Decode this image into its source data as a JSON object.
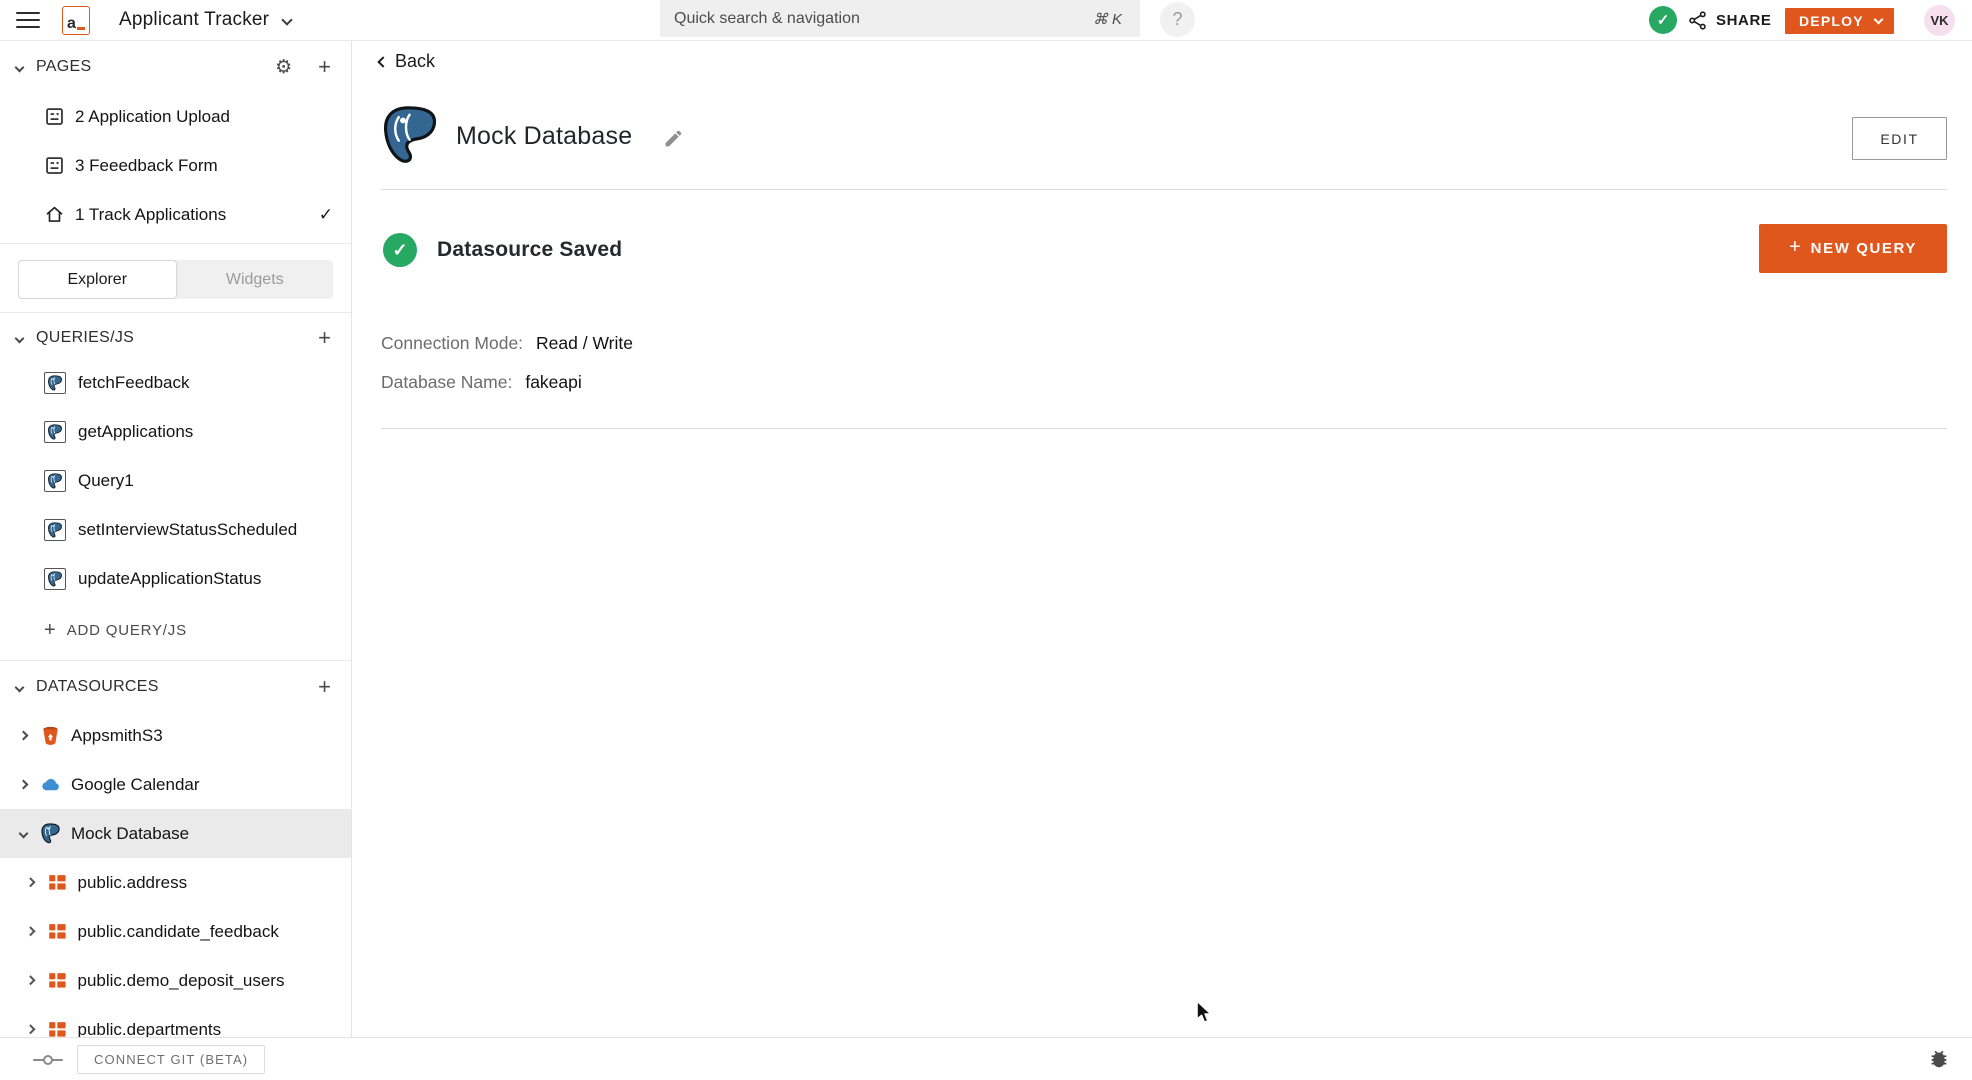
{
  "topbar": {
    "logo_glyph": "a",
    "app_title": "Applicant Tracker",
    "search": {
      "placeholder": "Quick search & navigation",
      "shortcut": "⌘ K"
    },
    "help_label": "?",
    "share_label": "SHARE",
    "deploy_label": "DEPLOY",
    "avatar_initials": "VK"
  },
  "sidebar": {
    "sections": {
      "pages": "PAGES",
      "queries": "QUERIES/JS",
      "datasources": "DATASOURCES"
    },
    "pages": [
      {
        "label": "2 Application Upload"
      },
      {
        "label": "3 Feeedback Form"
      },
      {
        "label": "1 Track Applications",
        "active": true
      }
    ],
    "tabs": [
      {
        "label": "Explorer",
        "active": true
      },
      {
        "label": "Widgets",
        "active": false
      }
    ],
    "queries": [
      "fetchFeedback",
      "getApplications",
      "Query1",
      "setInterviewStatusScheduled",
      "updateApplicationStatus"
    ],
    "add_query_label": "ADD QUERY/JS",
    "datasources": [
      {
        "label": "AppsmithS3"
      },
      {
        "label": "Google Calendar"
      },
      {
        "label": "Mock Database",
        "selected": true,
        "expanded": true
      }
    ],
    "tables": [
      "public.address",
      "public.candidate_feedback",
      "public.demo_deposit_users",
      "public.departments"
    ]
  },
  "bottombar": {
    "connect_git_label": "CONNECT GIT (BETA)"
  },
  "main": {
    "back_label": "Back",
    "title": "Mock Database",
    "edit_label": "EDIT",
    "status_text": "Datasource Saved",
    "plus_glyph": "+",
    "new_query_label": "NEW QUERY",
    "fields": [
      {
        "label": "Connection Mode:",
        "value": "Read / Write"
      },
      {
        "label": "Database Name:",
        "value": "fakeapi"
      }
    ]
  },
  "icons": {
    "gear": "⚙",
    "plus": "+",
    "check": "✓"
  },
  "colors": {
    "accent_orange": "#e0571e",
    "success_green": "#27a863",
    "postgres_blue": "#336791",
    "cloud_blue": "#3e8ed6",
    "avatar_pink": "#f6dfef",
    "selected_row": "#eaeaea"
  }
}
